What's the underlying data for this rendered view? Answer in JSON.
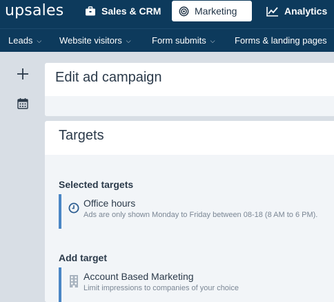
{
  "app": {
    "logo": "upsales"
  },
  "topnav": {
    "sales": {
      "label": "Sales & CRM",
      "icon": "briefcase-icon"
    },
    "marketing": {
      "label": "Marketing",
      "icon": "target-icon"
    },
    "analytics": {
      "label": "Analytics",
      "icon": "chart-icon"
    }
  },
  "subnav": {
    "items": [
      {
        "label": "Leads"
      },
      {
        "label": "Website visitors"
      },
      {
        "label": "Form submits"
      },
      {
        "label": "Forms & landing pages"
      }
    ]
  },
  "sidebar": {
    "add_icon": "plus-icon",
    "calendar_icon": "calendar-icon"
  },
  "page": {
    "title": "Edit ad campaign"
  },
  "targets": {
    "title": "Targets",
    "selected_title": "Selected targets",
    "selected": [
      {
        "name": "Office hours",
        "description": "Ads are only shown Monday to Friday between 08-18 (8 AM to 6 PM).",
        "icon": "clock-icon"
      }
    ],
    "add_title": "Add target",
    "add": [
      {
        "name": "Account Based Marketing",
        "description": "Limit impressions to companies of your choice",
        "icon": "building-icon"
      }
    ]
  },
  "colors": {
    "nav_bg": "#0d3a5c",
    "accent": "#4a86c5",
    "page_bg": "#d8dee5",
    "panel_bg": "#f2f5f8"
  }
}
